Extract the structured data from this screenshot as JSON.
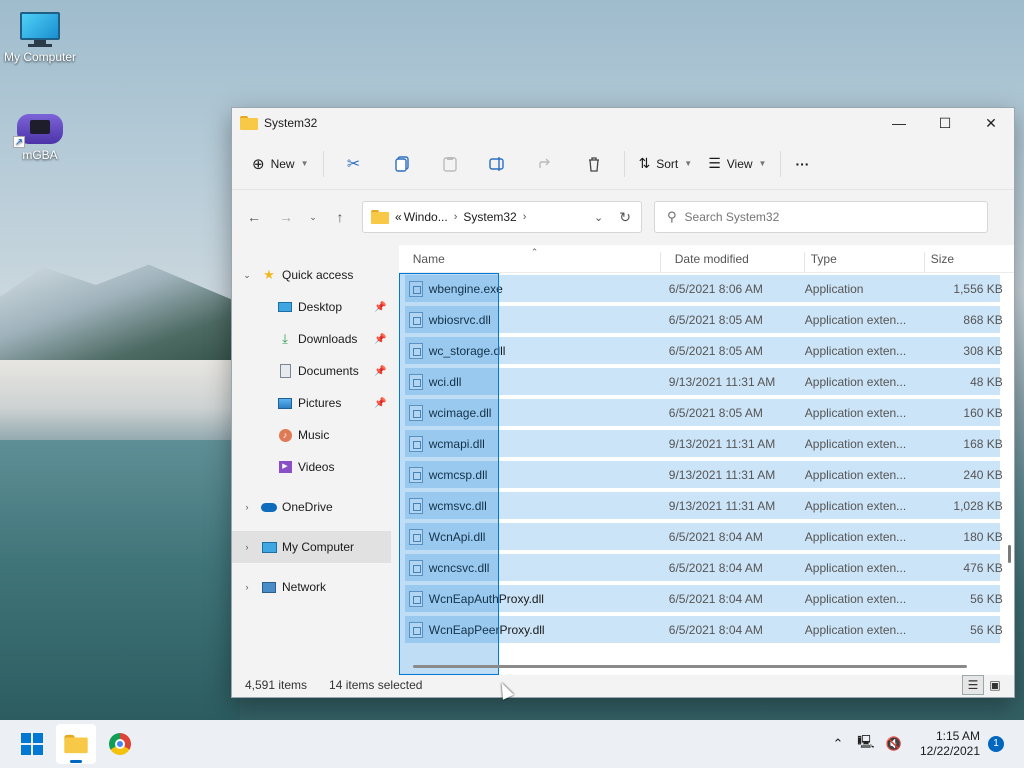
{
  "desktop": {
    "icons": [
      {
        "label": "My Computer",
        "icon": "monitor-icon"
      },
      {
        "label": "mGBA",
        "icon": "gba-icon"
      }
    ]
  },
  "window": {
    "title": "System32",
    "toolbar": {
      "new_label": "New",
      "sort_label": "Sort",
      "view_label": "View",
      "more_label": "···"
    },
    "address": {
      "prefix": "«",
      "crumbs": [
        "Windo...",
        "System32"
      ]
    },
    "search": {
      "placeholder": "Search System32"
    },
    "nav": {
      "quick_access": "Quick access",
      "desktop": "Desktop",
      "downloads": "Downloads",
      "documents": "Documents",
      "pictures": "Pictures",
      "music": "Music",
      "videos": "Videos",
      "onedrive": "OneDrive",
      "my_computer": "My Computer",
      "network": "Network"
    },
    "columns": {
      "name": "Name",
      "date": "Date modified",
      "type": "Type",
      "size": "Size"
    },
    "files": [
      {
        "name": "wbengine.exe",
        "date": "6/5/2021 8:06 AM",
        "type": "Application",
        "size": "1,556 KB"
      },
      {
        "name": "wbiosrvc.dll",
        "date": "6/5/2021 8:05 AM",
        "type": "Application exten...",
        "size": "868 KB"
      },
      {
        "name": "wc_storage.dll",
        "date": "6/5/2021 8:05 AM",
        "type": "Application exten...",
        "size": "308 KB"
      },
      {
        "name": "wci.dll",
        "date": "9/13/2021 11:31 AM",
        "type": "Application exten...",
        "size": "48 KB"
      },
      {
        "name": "wcimage.dll",
        "date": "6/5/2021 8:05 AM",
        "type": "Application exten...",
        "size": "160 KB"
      },
      {
        "name": "wcmapi.dll",
        "date": "9/13/2021 11:31 AM",
        "type": "Application exten...",
        "size": "168 KB"
      },
      {
        "name": "wcmcsp.dll",
        "date": "9/13/2021 11:31 AM",
        "type": "Application exten...",
        "size": "240 KB"
      },
      {
        "name": "wcmsvc.dll",
        "date": "9/13/2021 11:31 AM",
        "type": "Application exten...",
        "size": "1,028 KB"
      },
      {
        "name": "WcnApi.dll",
        "date": "6/5/2021 8:04 AM",
        "type": "Application exten...",
        "size": "180 KB"
      },
      {
        "name": "wcncsvc.dll",
        "date": "6/5/2021 8:04 AM",
        "type": "Application exten...",
        "size": "476 KB"
      },
      {
        "name": "WcnEapAuthProxy.dll",
        "date": "6/5/2021 8:04 AM",
        "type": "Application exten...",
        "size": "56 KB"
      },
      {
        "name": "WcnEapPeerProxy.dll",
        "date": "6/5/2021 8:04 AM",
        "type": "Application exten...",
        "size": "56 KB"
      }
    ],
    "status": {
      "count": "4,591 items",
      "selected": "14 items selected"
    }
  },
  "taskbar": {
    "time": "1:15 AM",
    "date": "12/22/2021",
    "notification_count": "1"
  },
  "colors": {
    "selection": "#cce4f7",
    "accent": "#0078d4"
  }
}
